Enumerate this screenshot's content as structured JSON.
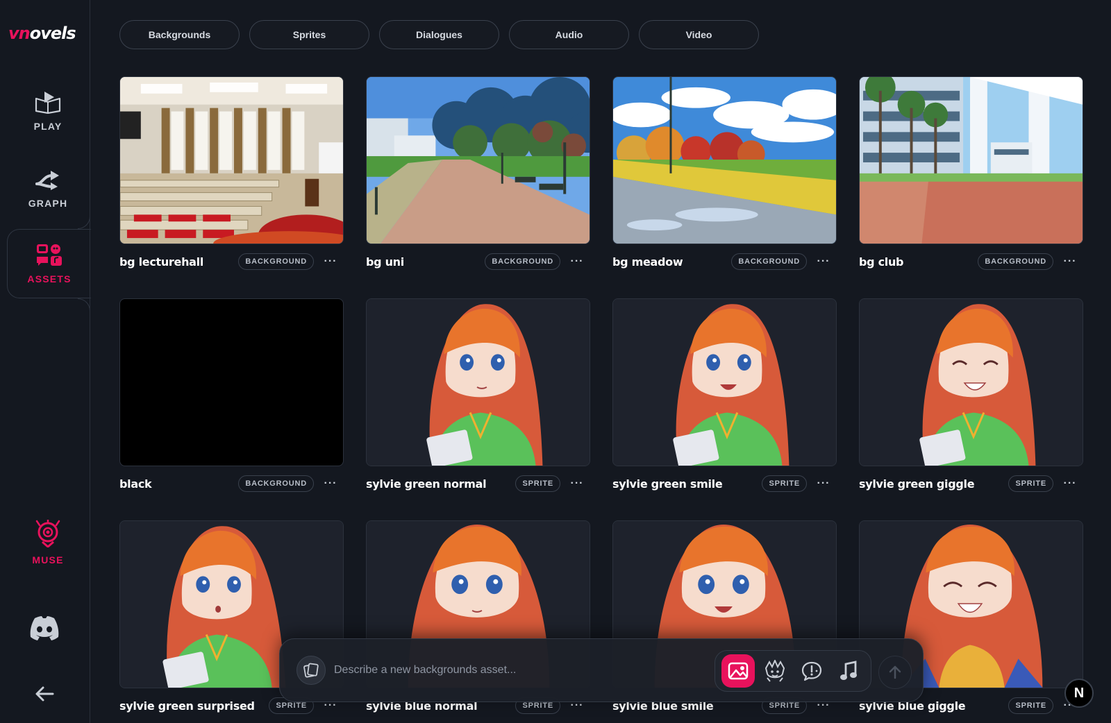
{
  "app": {
    "logo_prefix": "vn",
    "logo_suffix": "ovels"
  },
  "sidebar": {
    "items": [
      {
        "label": "PLAY",
        "icon": "book-play-icon"
      },
      {
        "label": "GRAPH",
        "icon": "branch-arrow-icon"
      },
      {
        "label": "ASSETS",
        "icon": "assets-grid-icon",
        "active": true
      },
      {
        "label": "MUSE",
        "icon": "muse-face-icon"
      }
    ],
    "discord_icon": "discord-icon",
    "back_icon": "arrow-left-icon"
  },
  "tabs": [
    "Backgrounds",
    "Sprites",
    "Dialogues",
    "Audio",
    "Video"
  ],
  "assets": [
    {
      "title": "bg lecturehall",
      "type": "BACKGROUND"
    },
    {
      "title": "bg uni",
      "type": "BACKGROUND"
    },
    {
      "title": "bg meadow",
      "type": "BACKGROUND"
    },
    {
      "title": "bg club",
      "type": "BACKGROUND"
    },
    {
      "title": "black",
      "type": "BACKGROUND"
    },
    {
      "title": "sylvie green normal",
      "type": "SPRITE"
    },
    {
      "title": "sylvie green smile",
      "type": "SPRITE"
    },
    {
      "title": "sylvie green giggle",
      "type": "SPRITE"
    },
    {
      "title": "sylvie green surprised",
      "type": "SPRITE"
    },
    {
      "title": "sylvie blue normal",
      "type": "SPRITE"
    },
    {
      "title": "sylvie blue smile",
      "type": "SPRITE"
    },
    {
      "title": "sylvie blue giggle",
      "type": "SPRITE"
    }
  ],
  "more_label": "···",
  "prompt": {
    "placeholder": "Describe a new backgrounds asset...",
    "types": [
      "image-icon",
      "character-icon",
      "dialogue-icon",
      "music-note-icon"
    ],
    "send_icon": "arrow-up-icon"
  },
  "corner_badge": "N",
  "colors": {
    "accent": "#e8125c",
    "background": "#141820",
    "card_border": "#2c323d"
  }
}
